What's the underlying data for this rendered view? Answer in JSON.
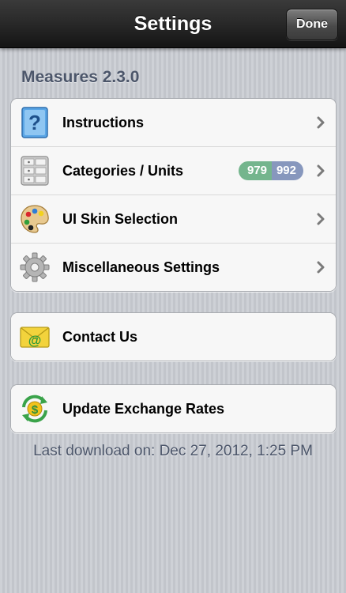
{
  "navbar": {
    "title": "Settings",
    "done_label": "Done"
  },
  "section_header": "Measures 2.3.0",
  "main_group": [
    {
      "label": "Instructions",
      "icon": "help-icon"
    },
    {
      "label": "Categories / Units",
      "icon": "categories-icon",
      "badge": [
        "979",
        "992"
      ]
    },
    {
      "label": "UI Skin Selection",
      "icon": "palette-icon"
    },
    {
      "label": "Miscellaneous Settings",
      "icon": "gear-icon"
    }
  ],
  "contact": {
    "label": "Contact Us",
    "icon": "email-icon"
  },
  "update": {
    "label": "Update Exchange Rates",
    "icon": "currency-refresh-icon"
  },
  "footer": {
    "text": "Last download on: Dec 27, 2012, 1:25 PM"
  },
  "colors": {
    "navbar": "#2a2a2a",
    "header_text": "#4c566a",
    "badge_left": "#74b58d",
    "badge_right": "#8797bd",
    "chevron": "#7a7a7a"
  }
}
